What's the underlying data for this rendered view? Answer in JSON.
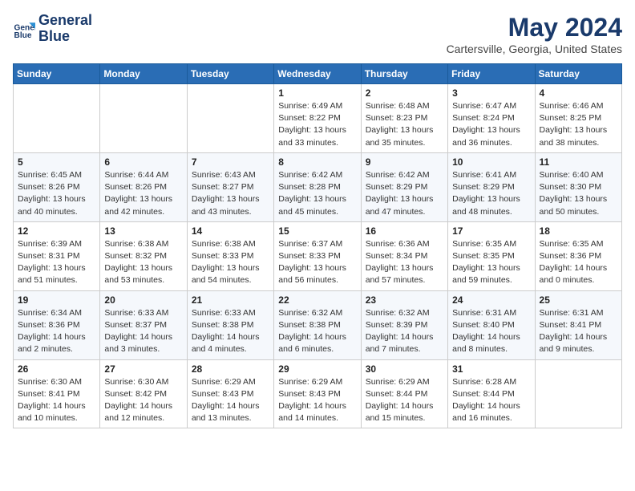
{
  "logo": {
    "line1": "General",
    "line2": "Blue"
  },
  "title": "May 2024",
  "subtitle": "Cartersville, Georgia, United States",
  "days_header": [
    "Sunday",
    "Monday",
    "Tuesday",
    "Wednesday",
    "Thursday",
    "Friday",
    "Saturday"
  ],
  "weeks": [
    [
      {
        "day": "",
        "info": ""
      },
      {
        "day": "",
        "info": ""
      },
      {
        "day": "",
        "info": ""
      },
      {
        "day": "1",
        "info": "Sunrise: 6:49 AM\nSunset: 8:22 PM\nDaylight: 13 hours\nand 33 minutes."
      },
      {
        "day": "2",
        "info": "Sunrise: 6:48 AM\nSunset: 8:23 PM\nDaylight: 13 hours\nand 35 minutes."
      },
      {
        "day": "3",
        "info": "Sunrise: 6:47 AM\nSunset: 8:24 PM\nDaylight: 13 hours\nand 36 minutes."
      },
      {
        "day": "4",
        "info": "Sunrise: 6:46 AM\nSunset: 8:25 PM\nDaylight: 13 hours\nand 38 minutes."
      }
    ],
    [
      {
        "day": "5",
        "info": "Sunrise: 6:45 AM\nSunset: 8:26 PM\nDaylight: 13 hours\nand 40 minutes."
      },
      {
        "day": "6",
        "info": "Sunrise: 6:44 AM\nSunset: 8:26 PM\nDaylight: 13 hours\nand 42 minutes."
      },
      {
        "day": "7",
        "info": "Sunrise: 6:43 AM\nSunset: 8:27 PM\nDaylight: 13 hours\nand 43 minutes."
      },
      {
        "day": "8",
        "info": "Sunrise: 6:42 AM\nSunset: 8:28 PM\nDaylight: 13 hours\nand 45 minutes."
      },
      {
        "day": "9",
        "info": "Sunrise: 6:42 AM\nSunset: 8:29 PM\nDaylight: 13 hours\nand 47 minutes."
      },
      {
        "day": "10",
        "info": "Sunrise: 6:41 AM\nSunset: 8:29 PM\nDaylight: 13 hours\nand 48 minutes."
      },
      {
        "day": "11",
        "info": "Sunrise: 6:40 AM\nSunset: 8:30 PM\nDaylight: 13 hours\nand 50 minutes."
      }
    ],
    [
      {
        "day": "12",
        "info": "Sunrise: 6:39 AM\nSunset: 8:31 PM\nDaylight: 13 hours\nand 51 minutes."
      },
      {
        "day": "13",
        "info": "Sunrise: 6:38 AM\nSunset: 8:32 PM\nDaylight: 13 hours\nand 53 minutes."
      },
      {
        "day": "14",
        "info": "Sunrise: 6:38 AM\nSunset: 8:33 PM\nDaylight: 13 hours\nand 54 minutes."
      },
      {
        "day": "15",
        "info": "Sunrise: 6:37 AM\nSunset: 8:33 PM\nDaylight: 13 hours\nand 56 minutes."
      },
      {
        "day": "16",
        "info": "Sunrise: 6:36 AM\nSunset: 8:34 PM\nDaylight: 13 hours\nand 57 minutes."
      },
      {
        "day": "17",
        "info": "Sunrise: 6:35 AM\nSunset: 8:35 PM\nDaylight: 13 hours\nand 59 minutes."
      },
      {
        "day": "18",
        "info": "Sunrise: 6:35 AM\nSunset: 8:36 PM\nDaylight: 14 hours\nand 0 minutes."
      }
    ],
    [
      {
        "day": "19",
        "info": "Sunrise: 6:34 AM\nSunset: 8:36 PM\nDaylight: 14 hours\nand 2 minutes."
      },
      {
        "day": "20",
        "info": "Sunrise: 6:33 AM\nSunset: 8:37 PM\nDaylight: 14 hours\nand 3 minutes."
      },
      {
        "day": "21",
        "info": "Sunrise: 6:33 AM\nSunset: 8:38 PM\nDaylight: 14 hours\nand 4 minutes."
      },
      {
        "day": "22",
        "info": "Sunrise: 6:32 AM\nSunset: 8:38 PM\nDaylight: 14 hours\nand 6 minutes."
      },
      {
        "day": "23",
        "info": "Sunrise: 6:32 AM\nSunset: 8:39 PM\nDaylight: 14 hours\nand 7 minutes."
      },
      {
        "day": "24",
        "info": "Sunrise: 6:31 AM\nSunset: 8:40 PM\nDaylight: 14 hours\nand 8 minutes."
      },
      {
        "day": "25",
        "info": "Sunrise: 6:31 AM\nSunset: 8:41 PM\nDaylight: 14 hours\nand 9 minutes."
      }
    ],
    [
      {
        "day": "26",
        "info": "Sunrise: 6:30 AM\nSunset: 8:41 PM\nDaylight: 14 hours\nand 10 minutes."
      },
      {
        "day": "27",
        "info": "Sunrise: 6:30 AM\nSunset: 8:42 PM\nDaylight: 14 hours\nand 12 minutes."
      },
      {
        "day": "28",
        "info": "Sunrise: 6:29 AM\nSunset: 8:43 PM\nDaylight: 14 hours\nand 13 minutes."
      },
      {
        "day": "29",
        "info": "Sunrise: 6:29 AM\nSunset: 8:43 PM\nDaylight: 14 hours\nand 14 minutes."
      },
      {
        "day": "30",
        "info": "Sunrise: 6:29 AM\nSunset: 8:44 PM\nDaylight: 14 hours\nand 15 minutes."
      },
      {
        "day": "31",
        "info": "Sunrise: 6:28 AM\nSunset: 8:44 PM\nDaylight: 14 hours\nand 16 minutes."
      },
      {
        "day": "",
        "info": ""
      }
    ]
  ]
}
